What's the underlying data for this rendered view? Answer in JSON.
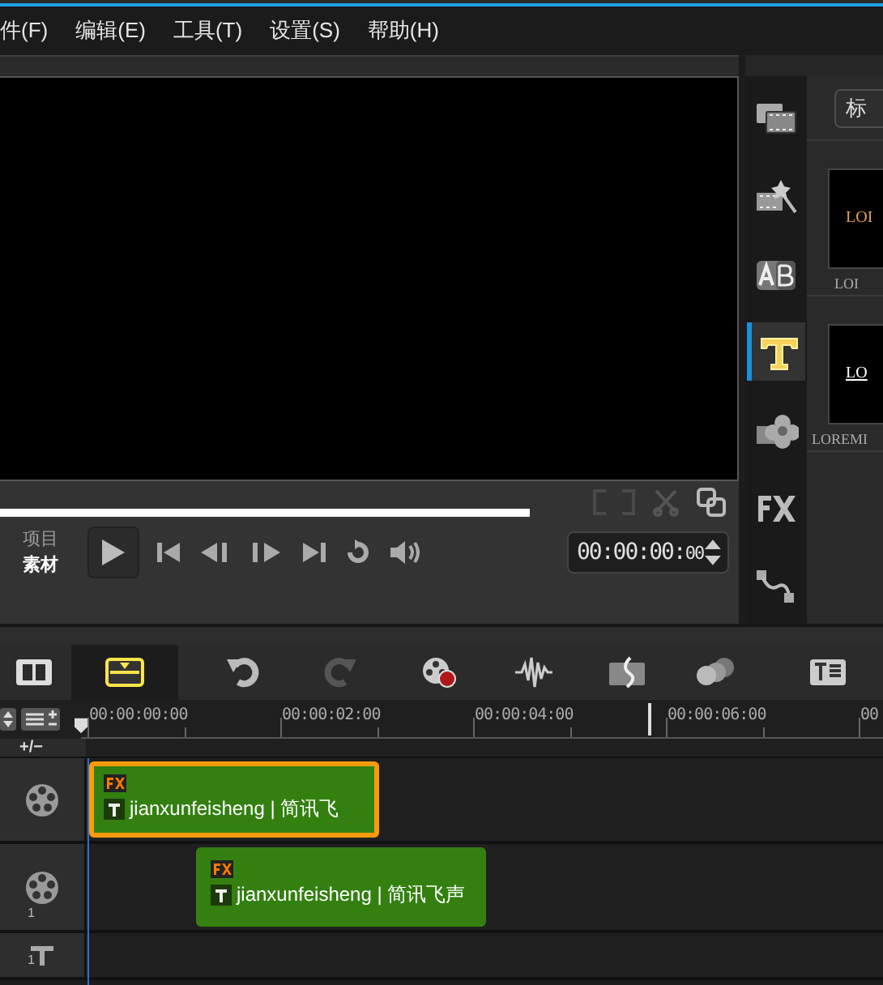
{
  "menu": [
    {
      "label": "件(F)"
    },
    {
      "label": "编辑(E)"
    },
    {
      "label": "工具(T)"
    },
    {
      "label": "设置(S)"
    },
    {
      "label": "帮助(H)"
    }
  ],
  "preview": {
    "modes": [
      {
        "label": "项目",
        "selected": false
      },
      {
        "label": "素材",
        "selected": true
      }
    ],
    "timecode": "00:00:00:",
    "timecode_frames": "00"
  },
  "library": {
    "side_tabs": [
      {
        "kind": "media",
        "selected": false
      },
      {
        "kind": "instant",
        "selected": false
      },
      {
        "kind": "transition",
        "selected": false
      },
      {
        "kind": "title",
        "selected": true
      },
      {
        "kind": "graphic",
        "selected": false
      },
      {
        "kind": "filter",
        "selected": false
      },
      {
        "kind": "path",
        "selected": false
      }
    ],
    "tab_label": "标",
    "items": [
      {
        "thumb_text": "LOI",
        "caption": "LOI"
      },
      {
        "thumb_text": "LO",
        "caption": "LOREMI"
      }
    ]
  },
  "timeline": {
    "tools": [
      {
        "kind": "storyboard",
        "selected": false
      },
      {
        "kind": "timeline",
        "selected": true
      },
      {
        "kind": "undo",
        "selected": false
      },
      {
        "kind": "redo",
        "selected": false
      },
      {
        "kind": "record",
        "selected": false
      },
      {
        "kind": "audio",
        "selected": false
      },
      {
        "kind": "music",
        "selected": false
      },
      {
        "kind": "motion",
        "selected": false
      },
      {
        "kind": "subtitle",
        "selected": false
      }
    ],
    "ruler": [
      "00:00:00:00",
      "00:00:02:00",
      "00:00:04:00",
      "00:00:06:00",
      "00"
    ],
    "track_button": "+/−",
    "tracks": [
      {
        "kind": "video",
        "clips": [
          {
            "text": "jianxunfeisheng | 简讯飞",
            "selected": true
          }
        ]
      },
      {
        "kind": "overlay",
        "number": "1",
        "clips": [
          {
            "text": "jianxunfeisheng | 简讯飞声",
            "selected": false
          }
        ]
      },
      {
        "kind": "title",
        "number": "1"
      }
    ]
  }
}
